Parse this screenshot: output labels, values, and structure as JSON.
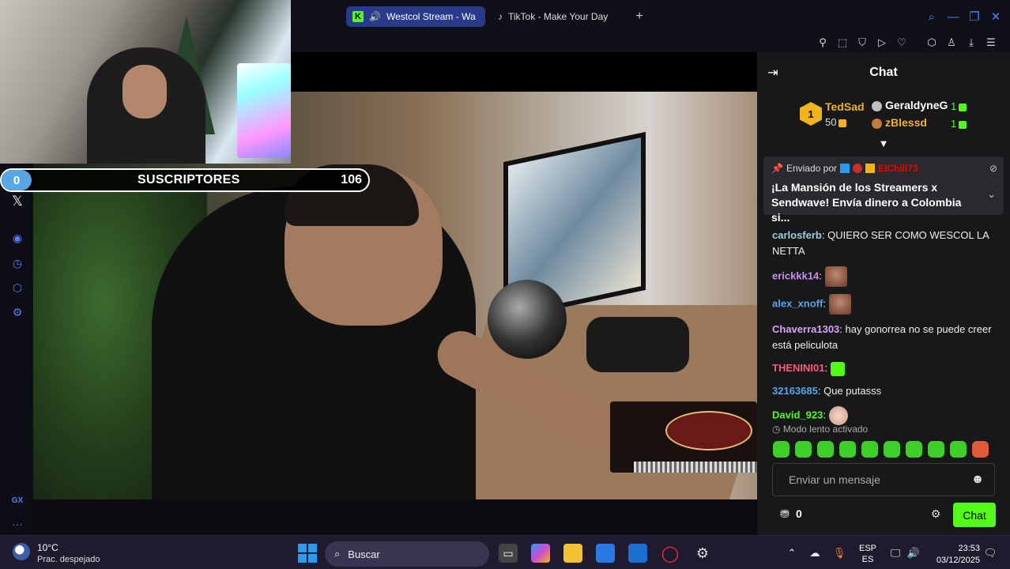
{
  "browser": {
    "tabs": [
      {
        "label": "Westcol Stream - Wa",
        "active": true,
        "icon": "kick-icon"
      },
      {
        "label": "TikTok - Make Your Day",
        "active": false,
        "icon": "tiktok-icon"
      }
    ],
    "new_tab": "+",
    "accent_color": "#5a7dff"
  },
  "overlay": {
    "subs_current": "0",
    "subs_label": "SUSCRIPTORES",
    "subs_goal": "106"
  },
  "sidebar": {
    "items": [
      "x-icon",
      "play-icon",
      "history-icon",
      "extensions-icon",
      "settings-icon",
      "gx-icon",
      "more-icon"
    ],
    "x_label": "𝕏",
    "gx_label": "GX",
    "more_label": "···"
  },
  "chat": {
    "title": "Chat",
    "leaderboard": {
      "first": {
        "rank": "1",
        "name": "TedSad",
        "value": "50"
      },
      "second": {
        "name": "GeraldyneG",
        "value": "1"
      },
      "third": {
        "name": "zBlessd",
        "value": "1"
      }
    },
    "pinned": {
      "sent_by": "Enviado por",
      "user": "ElChill73",
      "message": "¡La Mansión de los Streamers x Sendwave! Envía dinero a Colombia si..."
    },
    "messages": [
      {
        "user": "carlosferb",
        "color": "#9ad1d4",
        "text": "QUIERO SER COMO WESCOL LA NETTA",
        "emote": ""
      },
      {
        "user": "erickkk14",
        "color": "#c792ea",
        "text": "",
        "emote": "face"
      },
      {
        "user": "alex_xnoff",
        "color": "#5aa5e6",
        "text": "",
        "emote": "face"
      },
      {
        "user": "Chaverra1303",
        "color": "#d6a4f5",
        "text": "hay gonorrea no se puede creer está peliculota",
        "emote": ""
      },
      {
        "user": "THENINI01",
        "color": "#ff5a7a",
        "text": "",
        "emote": "green"
      },
      {
        "user": "32163685",
        "color": "#5aa5e6",
        "text": "Que putasss",
        "emote": ""
      },
      {
        "user": "David_923",
        "color": "#53fc18",
        "text": "",
        "emote": "baby"
      }
    ],
    "slow_mode": "Modo lento activado",
    "input_placeholder": "Enviar un mensaje",
    "points": "0",
    "send_label": "Chat",
    "brand_color": "#53fc18"
  },
  "taskbar": {
    "temperature": "10°C",
    "condition": "Prac. despejado",
    "search_label": "Buscar",
    "language_line1": "ESP",
    "language_line2": "ES",
    "time": "23:53",
    "date": "03/12/2025"
  }
}
